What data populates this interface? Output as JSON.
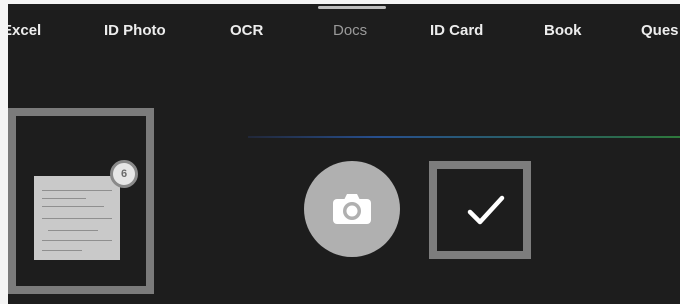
{
  "tabs": [
    {
      "label": "Excel",
      "active": false
    },
    {
      "label": "ID Photo",
      "active": false
    },
    {
      "label": "OCR",
      "active": false
    },
    {
      "label": "Docs",
      "active": true
    },
    {
      "label": "ID Card",
      "active": false
    },
    {
      "label": "Book",
      "active": false
    },
    {
      "label": "Ques",
      "active": false
    }
  ],
  "thumbnail": {
    "badge_count": "6"
  },
  "controls": {
    "shutter_icon": "camera-icon",
    "confirm_icon": "checkmark-icon"
  },
  "colors": {
    "background": "#1d1d1d",
    "frame": "#7b7b7b",
    "shutter": "#b0b0b0",
    "guide_line": "#274f8e"
  }
}
